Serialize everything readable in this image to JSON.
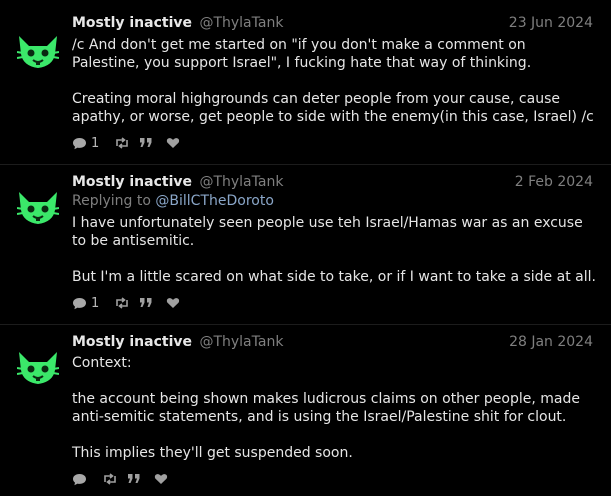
{
  "posts": [
    {
      "display_name": "Mostly inactive",
      "handle": "@ThylaTank",
      "date": "23 Jun 2024",
      "reply_prefix": "",
      "reply_to": "",
      "paragraphs": [
        "/c And don't get me started on \"if you don't make a comment on Palestine, you support Israel\", I fucking hate that way of thinking.",
        "Creating moral highgrounds can deter people from your cause, cause apathy, or worse, get people to side with the enemy(in this case, Israel) /c"
      ],
      "reply_count": "1"
    },
    {
      "display_name": "Mostly inactive",
      "handle": "@ThylaTank",
      "date": "2 Feb 2024",
      "reply_prefix": "Replying to",
      "reply_to": "@BillCTheDoroto",
      "paragraphs": [
        "I have unfortunately seen people use teh Israel/Hamas war as an excuse to be antisemitic.",
        "But I'm a little scared on what side to take, or if I want to take a side at all."
      ],
      "reply_count": "1"
    },
    {
      "display_name": "Mostly inactive",
      "handle": "@ThylaTank",
      "date": "28 Jan 2024",
      "reply_prefix": "",
      "reply_to": "",
      "paragraphs": [
        "Context:",
        "the account being shown makes ludicrous claims on other people, made anti-semitic statements, and is using the Israel/Palestine shit for clout.",
        "This implies they'll get suspended soon."
      ],
      "reply_count": ""
    }
  ],
  "icons": {
    "reply": "speech-bubble-icon",
    "repost": "repost-icon",
    "quote": "quote-icon",
    "like": "heart-icon",
    "avatar": "green-cat-face-icon"
  },
  "colors": {
    "background": "#000000",
    "text": "#e6e6e6",
    "muted": "#7f7f7f",
    "avatar": "#3be86a",
    "link": "#8aa6c8"
  }
}
